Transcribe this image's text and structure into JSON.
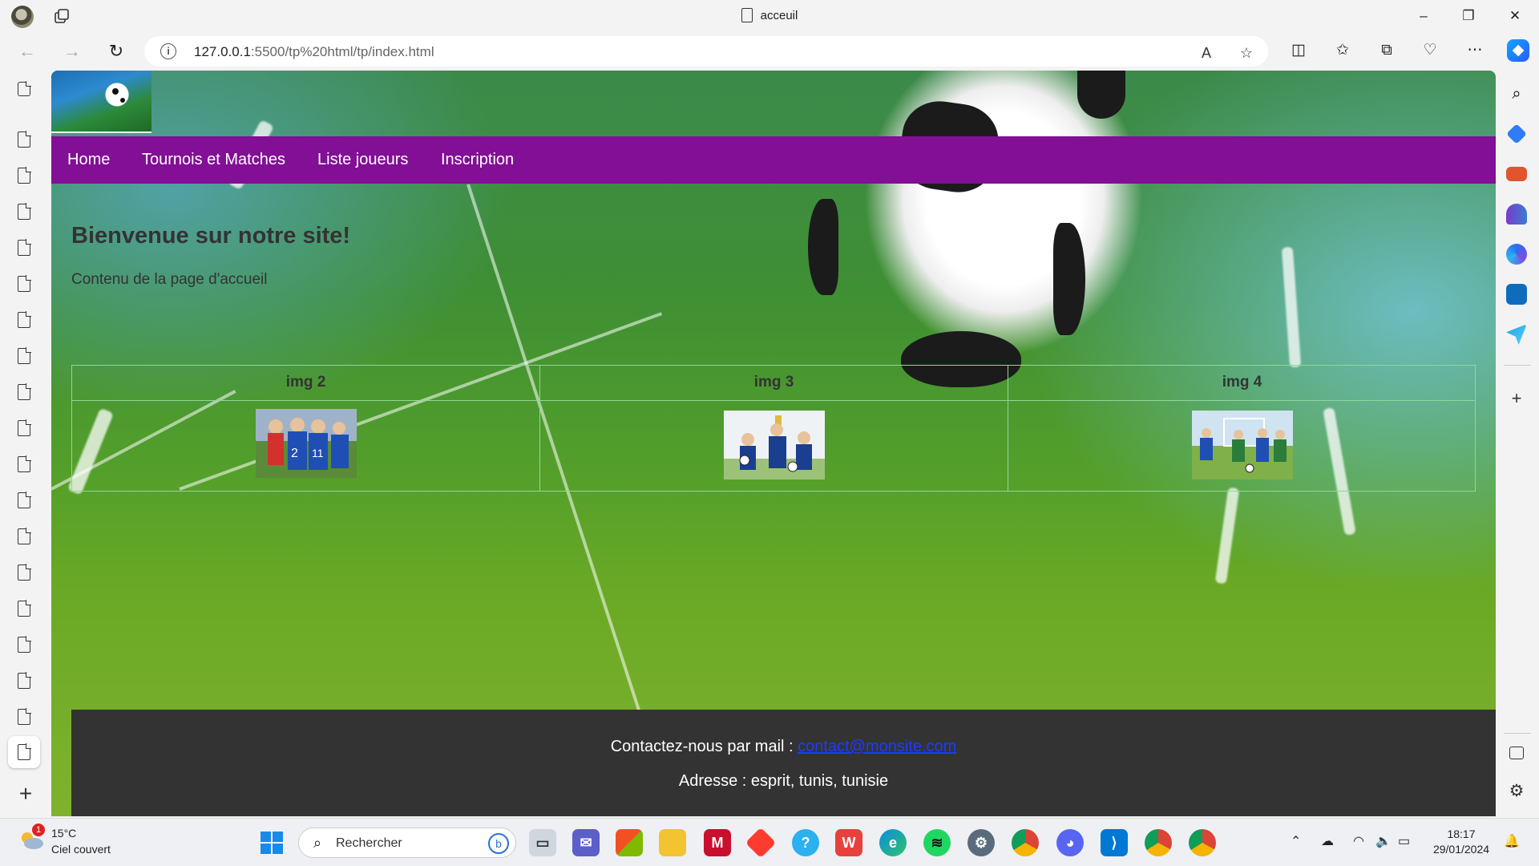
{
  "browser": {
    "tab_title": "acceuil",
    "url_host": "127.0.0.1",
    "url_rest": ":5500/tp%20html/tp/index.html",
    "window_controls": [
      "–",
      "❐",
      "✕"
    ]
  },
  "site": {
    "nav": [
      "Home",
      "Tournois et Matches",
      "Liste joueurs",
      "Inscription"
    ],
    "heading": "Bienvenue sur notre site!",
    "subtitle": "Contenu de la page d'accueil",
    "table": {
      "headers": [
        "img 2",
        "img 3",
        "img 4"
      ]
    },
    "footer": {
      "mail_prefix": "Contactez-nous par mail : ",
      "mail_link": "contact@monsite.com",
      "address": "Adresse : esprit, tunis, tunisie"
    },
    "colors": {
      "menu": "#820f95",
      "footer": "#333333",
      "table_border": "#8fd89a"
    }
  },
  "taskbar": {
    "weather_temp": "15°C",
    "weather_desc": "Ciel couvert",
    "weather_badge": "1",
    "search_placeholder": "Rechercher",
    "time": "18:17",
    "date": "29/01/2024"
  }
}
